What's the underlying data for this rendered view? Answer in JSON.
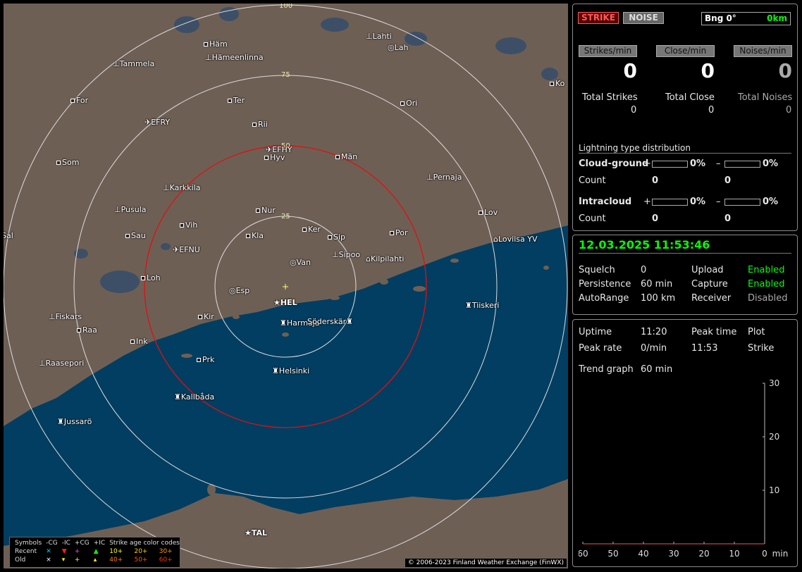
{
  "map": {
    "ring_labels": [
      "100",
      "75",
      "50",
      "25"
    ],
    "places": [
      {
        "name": "Häm",
        "type": "town"
      },
      {
        "name": "Hämeenlinna",
        "type": "station"
      },
      {
        "name": "Lahti",
        "type": "station"
      },
      {
        "name": "Lah",
        "type": "target"
      },
      {
        "name": "Tammela",
        "type": "station"
      },
      {
        "name": "Ko",
        "type": "town"
      },
      {
        "name": "For",
        "type": "town"
      },
      {
        "name": "Ter",
        "type": "town"
      },
      {
        "name": "Ori",
        "type": "town"
      },
      {
        "name": "EFRY",
        "type": "airport"
      },
      {
        "name": "Rii",
        "type": "town"
      },
      {
        "name": "EFHY",
        "type": "airport"
      },
      {
        "name": "Hyv",
        "type": "town"
      },
      {
        "name": "Män",
        "type": "town"
      },
      {
        "name": "Som",
        "type": "town"
      },
      {
        "name": "Pernaja",
        "type": "station"
      },
      {
        "name": "Karkkila",
        "type": "station"
      },
      {
        "name": "Pusula",
        "type": "station"
      },
      {
        "name": "Nur",
        "type": "town"
      },
      {
        "name": "Lov",
        "type": "town"
      },
      {
        "name": "Vih",
        "type": "town"
      },
      {
        "name": "Sal",
        "type": "town"
      },
      {
        "name": "Sau",
        "type": "town"
      },
      {
        "name": "Kla",
        "type": "town"
      },
      {
        "name": "Ker",
        "type": "town"
      },
      {
        "name": "Sip",
        "type": "town"
      },
      {
        "name": "Por",
        "type": "town"
      },
      {
        "name": "Loviisa YV",
        "type": "weather"
      },
      {
        "name": "EFNU",
        "type": "airport"
      },
      {
        "name": "Sipoo",
        "type": "station"
      },
      {
        "name": "Kilpilahti",
        "type": "weather"
      },
      {
        "name": "Van",
        "type": "target"
      },
      {
        "name": "Loh",
        "type": "town"
      },
      {
        "name": "Esp",
        "type": "target"
      },
      {
        "name": "HEL",
        "type": "star"
      },
      {
        "name": "Tiiskeri",
        "type": "lighthouse"
      },
      {
        "name": "Fiskars",
        "type": "station"
      },
      {
        "name": "Kir",
        "type": "town"
      },
      {
        "name": "Harmaja",
        "type": "lighthouse"
      },
      {
        "name": "Söderskär",
        "type": "lighthouse"
      },
      {
        "name": "Raa",
        "type": "town"
      },
      {
        "name": "Ink",
        "type": "town"
      },
      {
        "name": "Raasepori",
        "type": "station"
      },
      {
        "name": "Prk",
        "type": "town"
      },
      {
        "name": "Helsinki",
        "type": "lighthouse"
      },
      {
        "name": "Kallbåda",
        "type": "lighthouse"
      },
      {
        "name": "Jussarö",
        "type": "lighthouse"
      },
      {
        "name": "TAL",
        "type": "star"
      }
    ],
    "legend": {
      "header": [
        "Symbols",
        "-CG",
        "-IC",
        "+CG",
        "+IC",
        "Strike age color codes"
      ],
      "recent_label": "Recent",
      "old_label": "Old",
      "recent_codes": [
        "10+",
        "20+",
        "30+"
      ],
      "old_codes": [
        "40+",
        "50+",
        "60+"
      ]
    },
    "copyright": "© 2006-2023 Finland Weather Exchange (FinWX)",
    "colors": {
      "land": "#6e5f55",
      "sea": "#023e61",
      "lake": "#3d4f66",
      "ring": "#dcdcdc",
      "ring_active": "#e01010"
    }
  },
  "panel_top": {
    "strike_btn": "STRIKE",
    "noise_btn": "NOISE",
    "bearing": "Bng 0°",
    "distance": "0km",
    "strikes_per_min_label": "Strikes/min",
    "close_per_min_label": "Close/min",
    "noises_per_min_label": "Noises/min",
    "strikes_per_min": "0",
    "close_per_min": "0",
    "noises_per_min": "0",
    "total_strikes_label": "Total Strikes",
    "total_close_label": "Total Close",
    "total_noises_label": "Total Noises",
    "total_strikes": "0",
    "total_close": "0",
    "total_noises": "0",
    "distribution_title": "Lightning type distribution",
    "cg_label": "Cloud-ground",
    "ic_label": "Intracloud",
    "plus": "+",
    "minus": "–",
    "cg_plus_pct": "0%",
    "cg_minus_pct": "0%",
    "ic_plus_pct": "0%",
    "ic_minus_pct": "0%",
    "count_label": "Count",
    "cg_plus_count": "0",
    "cg_minus_count": "0",
    "ic_plus_count": "0",
    "ic_minus_count": "0"
  },
  "panel_mid": {
    "datetime": "12.03.2025 11:53:46",
    "squelch_label": "Squelch",
    "squelch": "0",
    "persistence_label": "Persistence",
    "persistence": "60 min",
    "autorange_label": "AutoRange",
    "autorange": "100 km",
    "upload_label": "Upload",
    "upload": "Enabled",
    "capture_label": "Capture",
    "capture": "Enabled",
    "receiver_label": "Receiver",
    "receiver": "Disabled"
  },
  "panel_bottom": {
    "uptime_label": "Uptime",
    "uptime": "11:20",
    "peak_time_label": "Peak time",
    "peak_time": "11:53",
    "plot_label": "Plot",
    "plot": "Strike",
    "peak_rate_label": "Peak rate",
    "peak_rate": "0/min",
    "trend_label": "Trend graph",
    "trend_window": "60 min"
  },
  "chart_data": {
    "type": "line",
    "title": "",
    "x": [
      60,
      50,
      40,
      30,
      20,
      10,
      0
    ],
    "x_tick_labels": [
      "60",
      "50",
      "40",
      "30",
      "20",
      "10",
      "0"
    ],
    "x_unit": "min",
    "y_ticks": [
      10,
      20,
      30
    ],
    "ylim": [
      0,
      30
    ],
    "series": [
      {
        "values": [
          0,
          0,
          0,
          0,
          0,
          0,
          0
        ]
      }
    ],
    "grid": false
  }
}
